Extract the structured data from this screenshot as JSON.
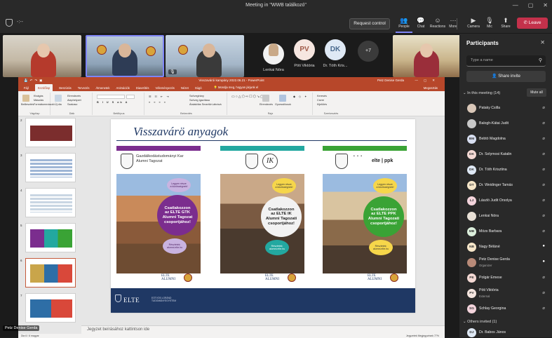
{
  "window": {
    "title": "Meeting in \"WWB találkozó\"",
    "controls": [
      "—",
      "▢",
      "✕"
    ]
  },
  "toolbar": {
    "timer": "-:--",
    "request_control": "Request control",
    "tools": [
      {
        "label": "People",
        "icon": "people-icon"
      },
      {
        "label": "Chat",
        "icon": "chat-icon"
      },
      {
        "label": "Reactions",
        "icon": "reactions-icon"
      },
      {
        "label": "More",
        "icon": "more-icon"
      },
      {
        "label": "Camera",
        "icon": "camera-icon"
      },
      {
        "label": "Mic",
        "icon": "mic-icon"
      },
      {
        "label": "Share",
        "icon": "share-icon"
      }
    ],
    "leave": "Leave"
  },
  "gallery": {
    "avatars": [
      {
        "initials": "",
        "name": "Lenkai Nóra",
        "color": "#f2f2f2"
      },
      {
        "initials": "PV",
        "name": "Pöti Viktória",
        "color": "#f6e6e0"
      },
      {
        "initials": "DK",
        "name": "Dr. Tóth Kris...",
        "color": "#dfe9f5"
      }
    ],
    "more": "+7"
  },
  "ppt": {
    "title": "Visszavárói kampány 2022.06.21 - PowerPoint",
    "user": "Petz Denise Gerda",
    "tabs": [
      "Fájl",
      "Kezdőlap",
      "Beszúrás",
      "Tervezés",
      "Átmenetek",
      "Animációk",
      "Diavetítés",
      "Véleményezés",
      "Nézet",
      "Súgó"
    ],
    "tell": "Mondja meg, hogyan járjunk el",
    "share": "Megosztás",
    "ribbon_groups": [
      "Vágólap",
      "Diák",
      "Betűtípus",
      "Bekezdés",
      "Rajz",
      "Szerkesztés"
    ],
    "ribbon_items": {
      "paste": "Beillesztés",
      "cut": "Kivágás",
      "copy": "Másolás",
      "format": "Formátummásoló",
      "new_slide": "Új dia",
      "layout": "Elrendezés",
      "reset": "Alaphelyzet",
      "section": "Szakasz",
      "text_dir": "Szövegirány",
      "align": "Szöveg igazítása",
      "smartart": "Átalakítás SmartArt-ábrává",
      "arrange": "Elrendezés",
      "quick": "Gyorsstílusok",
      "find": "Keresés",
      "replace": "Csere",
      "select": "Kijelölés"
    },
    "thumb_numbers": [
      "2",
      "3",
      "4",
      "5",
      "6",
      "7"
    ],
    "notes": "Jegyzet beírásához kattintson ide",
    "status_left": "Dia 6 / 6  magyar",
    "status_right": "Jegyzetek    Megjegyzések    77%"
  },
  "slide": {
    "title": "Visszavárö anyagok",
    "panels": [
      {
        "bar_color": "#7b2d8e",
        "header": "Gazdálkodástudományi Kar\nAlumni Tagozat",
        "cta": "Csatlakozzon\naz ELTE GTK\nAlumni Tagozat\ncsoportjához!",
        "cta_color": "#7b2d8e",
        "bubble_top": "Legyen része\na közösségnek!",
        "bubble_bottom": "Részletek:\nalumni.elte.hu",
        "bubble_color": "#c9b3e0",
        "brand": "ELTE\nALUMNI"
      },
      {
        "bar_color": "#23a8a0",
        "header": "IK",
        "cta": "Csatlakozzon\naz ELTE IK\nAlumni Tagozati\ncsoportjához!",
        "cta_color": "#2b2b2b",
        "bubble_top": "Legyen része\na közösségnek!",
        "bubble_bottom": "Részletek:\nalumni.elte.hu",
        "bubble_color": "#23a8a0",
        "brand": "ELTE\nALUMNI"
      },
      {
        "bar_color": "#3aa335",
        "header": "elte | ppk",
        "cta": "Csatlakozzon\naz ELTE PPK\nAlumni Tagozati\ncsoportjához!",
        "cta_color": "#3aa335",
        "bubble_top": "Legyen része\na közösségnek!",
        "bubble_bottom": "Részletek:\nalumni.elte.hu",
        "bubble_color": "#f6d64a",
        "brand": "ELTE\nALUMNI"
      }
    ],
    "footer_logo": "ELTE",
    "footer_sub": "EÖTVÖS LORÁND\nTUDOMÁNYEGYETEM"
  },
  "speaker_label": "Petz Denise Gerda",
  "participants": {
    "title": "Participants",
    "search_placeholder": "Type a name",
    "share_invite": "Share invite",
    "in_meeting": "In this meeting (14)",
    "mute_all": "Mute all",
    "list": [
      {
        "name": "Pataky Csilla",
        "initials": "",
        "role": "",
        "mic": "muted",
        "color": "#d9c7b8"
      },
      {
        "name": "Balogh-Kátai Judit",
        "initials": "",
        "role": "",
        "mic": "muted",
        "color": "#c9c9c9"
      },
      {
        "name": "Bebtó Magdolna",
        "initials": "BM",
        "role": "",
        "mic": "muted",
        "color": "#d7def0"
      },
      {
        "name": "Dr. Solymosi Katalin",
        "initials": "DK",
        "role": "",
        "mic": "muted",
        "color": "#f4d9d4"
      },
      {
        "name": "Dr. Tóth Krisztina",
        "initials": "DK",
        "role": "",
        "mic": "muted",
        "color": "#dfe9f5"
      },
      {
        "name": "Dr. Weidinger Tamás",
        "initials": "DT",
        "role": "",
        "mic": "muted",
        "color": "#f6e6c9"
      },
      {
        "name": "László Judit Orsolya",
        "initials": "LJ",
        "role": "",
        "mic": "muted",
        "color": "#f4d4dc"
      },
      {
        "name": "Lenkai Nóra",
        "initials": "",
        "role": "",
        "mic": "muted",
        "color": "#e8e0d6"
      },
      {
        "name": "Mózs Barbara",
        "initials": "MB",
        "role": "",
        "mic": "muted",
        "color": "#dcefdc"
      },
      {
        "name": "Nagy Béláné",
        "initials": "NB",
        "role": "",
        "mic": "on",
        "color": "#f6e6c9"
      },
      {
        "name": "Petz Denise Gerda",
        "initials": "",
        "role": "Organizer",
        "mic": "on",
        "color": "#b88a78"
      },
      {
        "name": "Polgár Emese",
        "initials": "PE",
        "role": "",
        "mic": "muted",
        "color": "#f4d9d4"
      },
      {
        "name": "Pöti Viktória",
        "initials": "PV",
        "role": "External",
        "mic": "muted",
        "color": "#f6e6e0"
      },
      {
        "name": "Schlay Georgina",
        "initials": "SG",
        "role": "",
        "mic": "muted",
        "color": "#f4d4dc"
      }
    ],
    "others_invited": "Others invited (1)",
    "invited": {
      "name": "Dr. Babos János",
      "initials": "DJ",
      "color": "#dfe9f5"
    }
  }
}
